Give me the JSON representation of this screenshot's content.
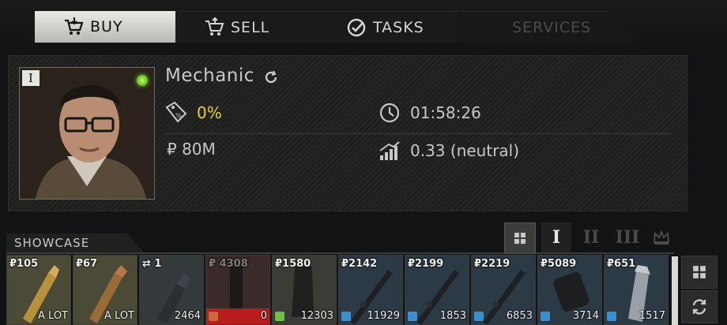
{
  "tabs": {
    "buy": "BUY",
    "sell": "SELL",
    "tasks": "TASKS",
    "services": "SERVICES"
  },
  "trader": {
    "level": "I",
    "name": "Mechanic",
    "discount": "0%",
    "restock_timer": "01:58:26",
    "funds": "₽ 80M",
    "standing": "0.33 (neutral)"
  },
  "showcase": {
    "title": "SHOWCASE",
    "filters": [
      "I",
      "II",
      "III"
    ],
    "items": [
      {
        "price": "₽105",
        "qty": "A LOT",
        "kind": "round-brass",
        "bg": "#4a4a36"
      },
      {
        "price": "₽67",
        "qty": "A LOT",
        "kind": "round-copper",
        "bg": "#4a4a36"
      },
      {
        "price": "⇄ 1",
        "qty": "2464",
        "kind": "grenade",
        "bg": "#34393c"
      },
      {
        "price": "₽ 4308",
        "qty": "0",
        "kind": "dark",
        "bg": "#3a2a2a",
        "sold_out": true
      },
      {
        "price": "₽1580",
        "qty": "12303",
        "kind": "stock",
        "bg": "#3a3c36",
        "tag": "#6fbf44"
      },
      {
        "price": "₽2142",
        "qty": "11929",
        "kind": "barrel",
        "bg": "#2c3a45",
        "tag": "#3b8fd1"
      },
      {
        "price": "₽2199",
        "qty": "1853",
        "kind": "barrel",
        "bg": "#2c3a45",
        "tag": "#3b8fd1"
      },
      {
        "price": "₽2219",
        "qty": "6853",
        "kind": "barrel",
        "bg": "#2c3a45",
        "tag": "#3b8fd1"
      },
      {
        "price": "₽5089",
        "qty": "3714",
        "kind": "handguard",
        "bg": "#2c3a45",
        "tag": "#3b8fd1"
      },
      {
        "price": "₽651",
        "qty": "1517",
        "kind": "muzzle",
        "bg": "#2c3a45",
        "tag": "#3b8fd1"
      }
    ]
  },
  "colors": {
    "discount": "#e8d42a",
    "active_tab": "#dcddd8",
    "online": "#7bd12a",
    "sold_out": "#b81c1c"
  }
}
